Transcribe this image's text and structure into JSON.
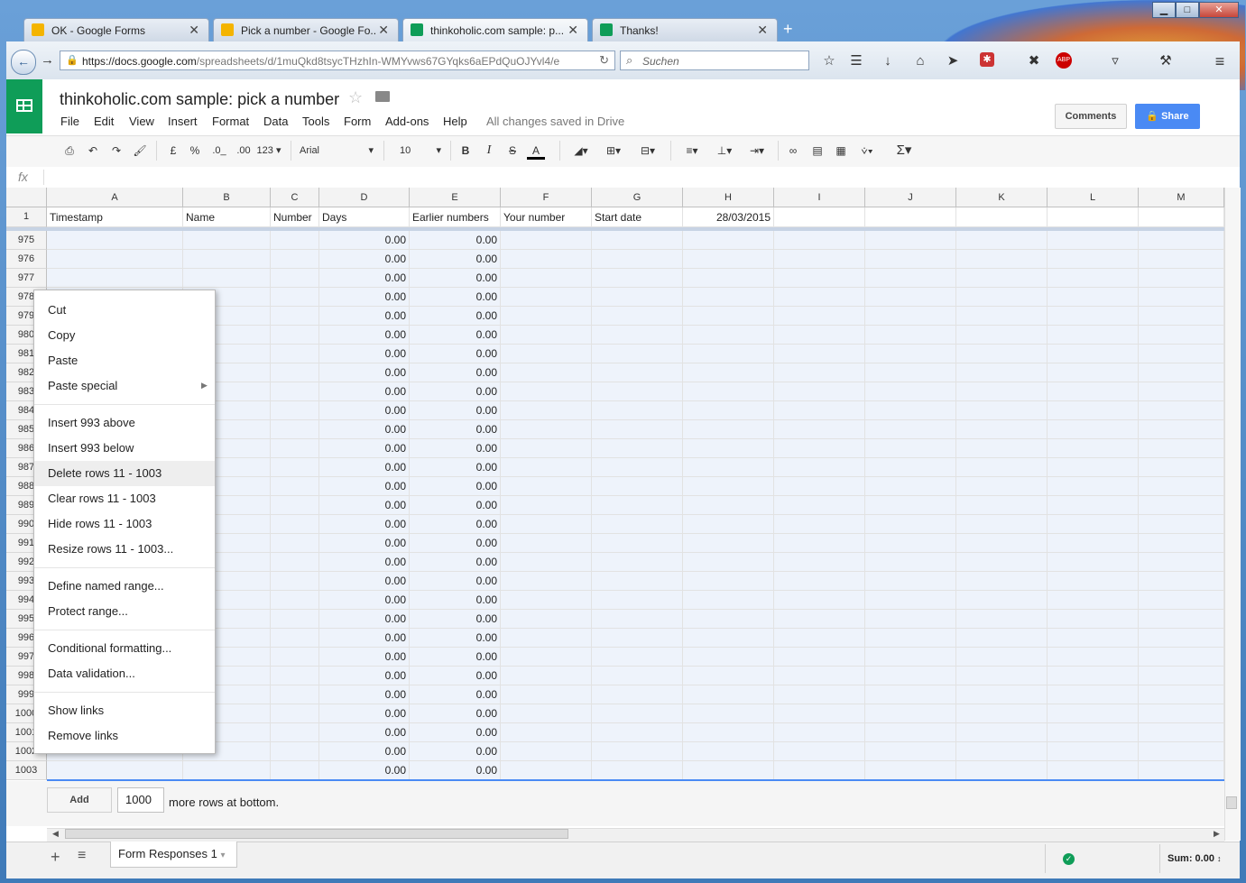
{
  "browser": {
    "tabs": [
      {
        "title": "OK - Google Forms",
        "icon": "drive-icon"
      },
      {
        "title": "Pick a number - Google Fo...",
        "icon": "drive-icon"
      },
      {
        "title": "thinkoholic.com sample: p...",
        "icon": "sheets-icon"
      },
      {
        "title": "Thanks!",
        "icon": "forms-icon"
      }
    ],
    "url_domain": "https://docs.google.com",
    "url_path": "/spreadsheets/d/1muQkd8tsycTHzhIn-WMYvws67GYqks6aEPdQuOJYvl4/e",
    "search_placeholder": "Suchen"
  },
  "doc": {
    "title": "thinkoholic.com sample: pick a number",
    "menus": [
      "File",
      "Edit",
      "View",
      "Insert",
      "Format",
      "Data",
      "Tools",
      "Form",
      "Add-ons",
      "Help"
    ],
    "saved_status": "All changes saved in Drive",
    "comments_label": "Comments",
    "share_label": "Share"
  },
  "toolbar": {
    "currency": "£",
    "percent": "%",
    "dec_less": ".0_",
    "dec_more": ".00",
    "format_more": "123",
    "font": "Arial",
    "font_size": "10",
    "bold": "B",
    "italic": "I",
    "strike": "S",
    "text_color": "A"
  },
  "formula_bar": {
    "fx": "fx"
  },
  "grid": {
    "columns": [
      "A",
      "B",
      "C",
      "D",
      "E",
      "F",
      "G",
      "H",
      "I",
      "J",
      "K",
      "L",
      "M"
    ],
    "header_row": {
      "number": "1",
      "cells": [
        "Timestamp",
        "Name",
        "Number",
        "Days",
        "Earlier numbers",
        "Your number",
        "Start date",
        "28/03/2015",
        "",
        "",
        "",
        "",
        ""
      ]
    },
    "rows": [
      "975",
      "976",
      "977",
      "978",
      "979",
      "980",
      "981",
      "982",
      "983",
      "984",
      "985",
      "986",
      "987",
      "988",
      "989",
      "990",
      "991",
      "992",
      "993",
      "994",
      "995",
      "996",
      "997",
      "998",
      "999",
      "1000",
      "1001",
      "1002",
      "1003"
    ],
    "d_value": "0.00",
    "e_value": "0.00"
  },
  "context_menu": {
    "groups": [
      [
        "Cut",
        "Copy",
        "Paste",
        "Paste special"
      ],
      [
        "Insert 993 above",
        "Insert 993 below",
        "Delete rows 11 - 1003",
        "Clear rows 11 - 1003",
        "Hide rows 11 - 1003",
        "Resize rows 11 - 1003..."
      ],
      [
        "Define named range...",
        "Protect range..."
      ],
      [
        "Conditional formatting...",
        "Data validation..."
      ],
      [
        "Show links",
        "Remove links"
      ]
    ],
    "highlighted": "Delete rows 11 - 1003"
  },
  "bottom": {
    "add_label": "Add",
    "rows_value": "1000",
    "more_rows_text": "more rows at bottom.",
    "sheet_tab": "Form Responses 1",
    "sum_label": "Sum: 0.00"
  },
  "colors": {
    "sheets_green": "#0f9d58",
    "share_blue": "#4a8af4",
    "selection": "#eef3fb"
  }
}
